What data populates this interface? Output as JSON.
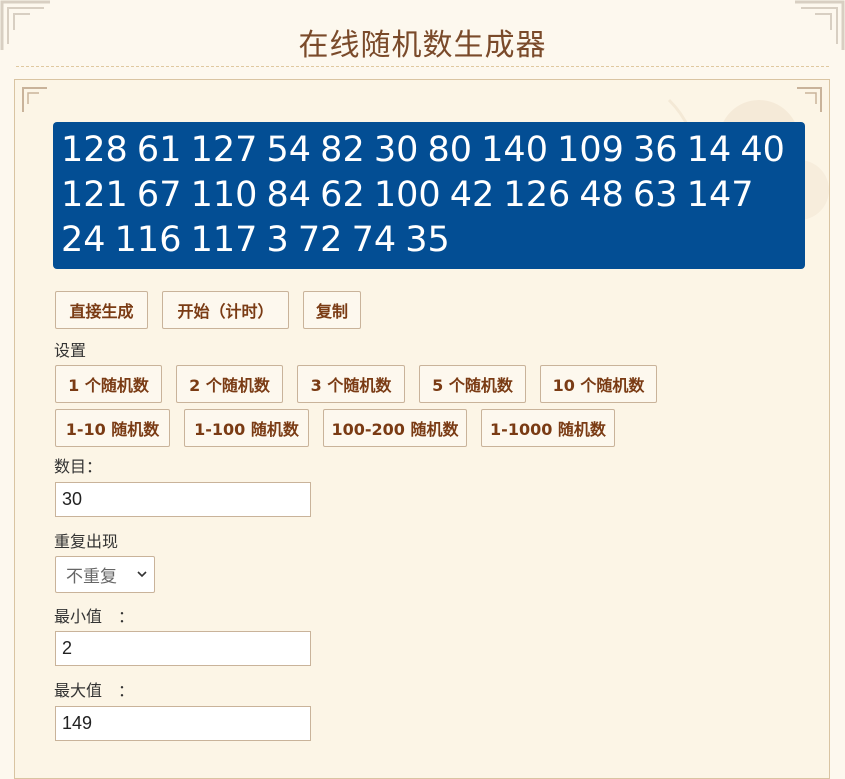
{
  "page": {
    "title": "在线随机数生成器"
  },
  "result": {
    "text": "128 61 127 54 82 30 80 140 109 36 14 40 121 67 110 84 62 100 42 126 48 63 147 24 116 117 3 72 74 35"
  },
  "actions": {
    "generate": "直接生成",
    "start_timer": "开始（计时）",
    "copy": "复制"
  },
  "settings": {
    "heading": "设置",
    "presets_count": [
      "1 个随机数",
      "2 个随机数",
      "3 个随机数",
      "5 个随机数",
      "10 个随机数"
    ],
    "presets_range": [
      "1-10 随机数",
      "1-100 随机数",
      "100-200 随机数",
      "1-1000 随机数"
    ]
  },
  "form": {
    "count_label": "数目：",
    "count_value": "30",
    "repeat_label": "重复出现",
    "repeat_value": "不重复",
    "min_label": "最小值　：",
    "min_value": "2",
    "max_label": "最大值　：",
    "max_value": "149"
  },
  "colors": {
    "result_bg": "#034e94",
    "button_text": "#7a3b14",
    "title": "#7a4a2a"
  }
}
